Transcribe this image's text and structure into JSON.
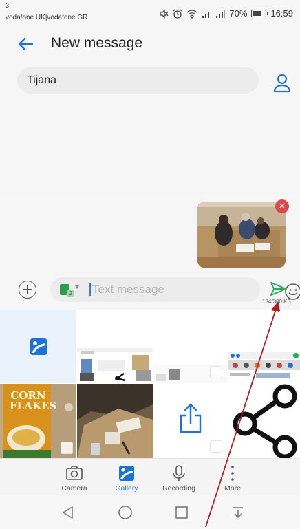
{
  "status_bar": {
    "carrier_line1": "3",
    "carrier_line2": "vodafone UK|vodafone GR",
    "battery": "70%",
    "time": "16:59"
  },
  "toolbar": {
    "title": "New message"
  },
  "recipient": {
    "name": "Tijana"
  },
  "composer": {
    "placeholder": "Text message",
    "size_counter": "184/300 KB"
  },
  "tabs": [
    {
      "label": "Camera"
    },
    {
      "label": "Gallery",
      "active": true
    },
    {
      "label": "Recording"
    },
    {
      "label": "More"
    }
  ],
  "gallery": {
    "cornflakes_line1": "CORN",
    "cornflakes_line2": "FLAKES"
  },
  "colors": {
    "accent": "#1e73d8",
    "send": "#2bab5b",
    "remove": "#e24747",
    "annotation_arrow": "#b21d1d"
  }
}
